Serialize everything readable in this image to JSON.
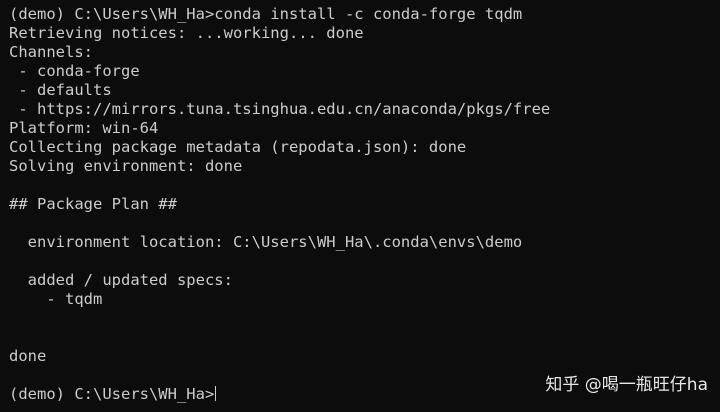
{
  "terminal": {
    "lines": [
      "(demo) C:\\Users\\WH_Ha>conda install -c conda-forge tqdm",
      "Retrieving notices: ...working... done",
      "Channels:",
      " - conda-forge",
      " - defaults",
      " - https://mirrors.tuna.tsinghua.edu.cn/anaconda/pkgs/free",
      "Platform: win-64",
      "Collecting package metadata (repodata.json): done",
      "Solving environment: done",
      "## Package Plan ##",
      "  environment location: C:\\Users\\WH_Ha\\.conda\\envs\\demo",
      "  added / updated specs:",
      "    - tqdm",
      "done",
      "(demo) C:\\Users\\WH_Ha>"
    ]
  },
  "watermark": {
    "text": "知乎 @喝一瓶旺仔ha"
  }
}
